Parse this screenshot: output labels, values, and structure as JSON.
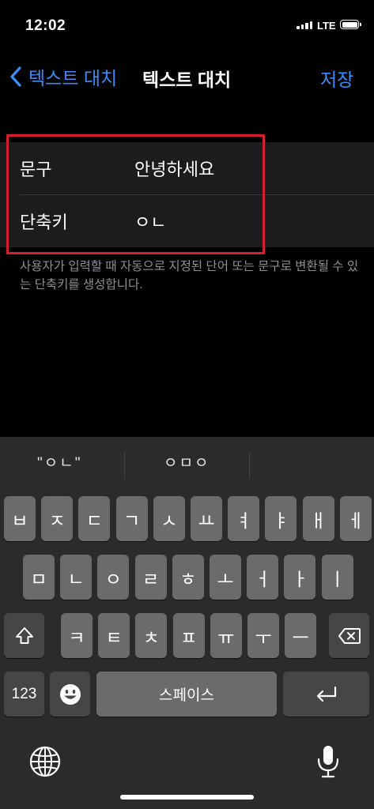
{
  "status_bar": {
    "time": "12:02",
    "network": "LTE"
  },
  "nav": {
    "back_label": "텍스트 대치",
    "title": "텍스트 대치",
    "save_label": "저장"
  },
  "form": {
    "phrase_label": "문구",
    "phrase_value": "안녕하세요",
    "shortcut_label": "단축키",
    "shortcut_value": "ㅇㄴ"
  },
  "footnote": "사용자가 입력할 때 자동으로 지정된 단어 또는 문구로 변환될 수 있는 단축키를 생성합니다.",
  "suggestions": [
    "\"ㅇㄴ\"",
    "ㅇㅁㅇ"
  ],
  "keyboard": {
    "row1": [
      "ㅂ",
      "ㅈ",
      "ㄷ",
      "ㄱ",
      "ㅅ",
      "ㅛ",
      "ㅕ",
      "ㅑ",
      "ㅐ",
      "ㅔ"
    ],
    "row2": [
      "ㅁ",
      "ㄴ",
      "ㅇ",
      "ㄹ",
      "ㅎ",
      "ㅗ",
      "ㅓ",
      "ㅏ",
      "ㅣ"
    ],
    "row3": [
      "ㅋ",
      "ㅌ",
      "ㅊ",
      "ㅍ",
      "ㅠ",
      "ㅜ",
      "ㅡ"
    ],
    "numbers_label": "123",
    "space_label": "스페이스"
  },
  "icons": {
    "back": "chevron-left-icon",
    "shift": "shift-icon",
    "delete": "delete-icon",
    "emoji": "emoji-icon",
    "return": "return-icon",
    "globe": "globe-icon",
    "mic": "microphone-icon"
  },
  "colors": {
    "accent": "#3d8bf5",
    "highlight_box": "#d21f2b"
  }
}
